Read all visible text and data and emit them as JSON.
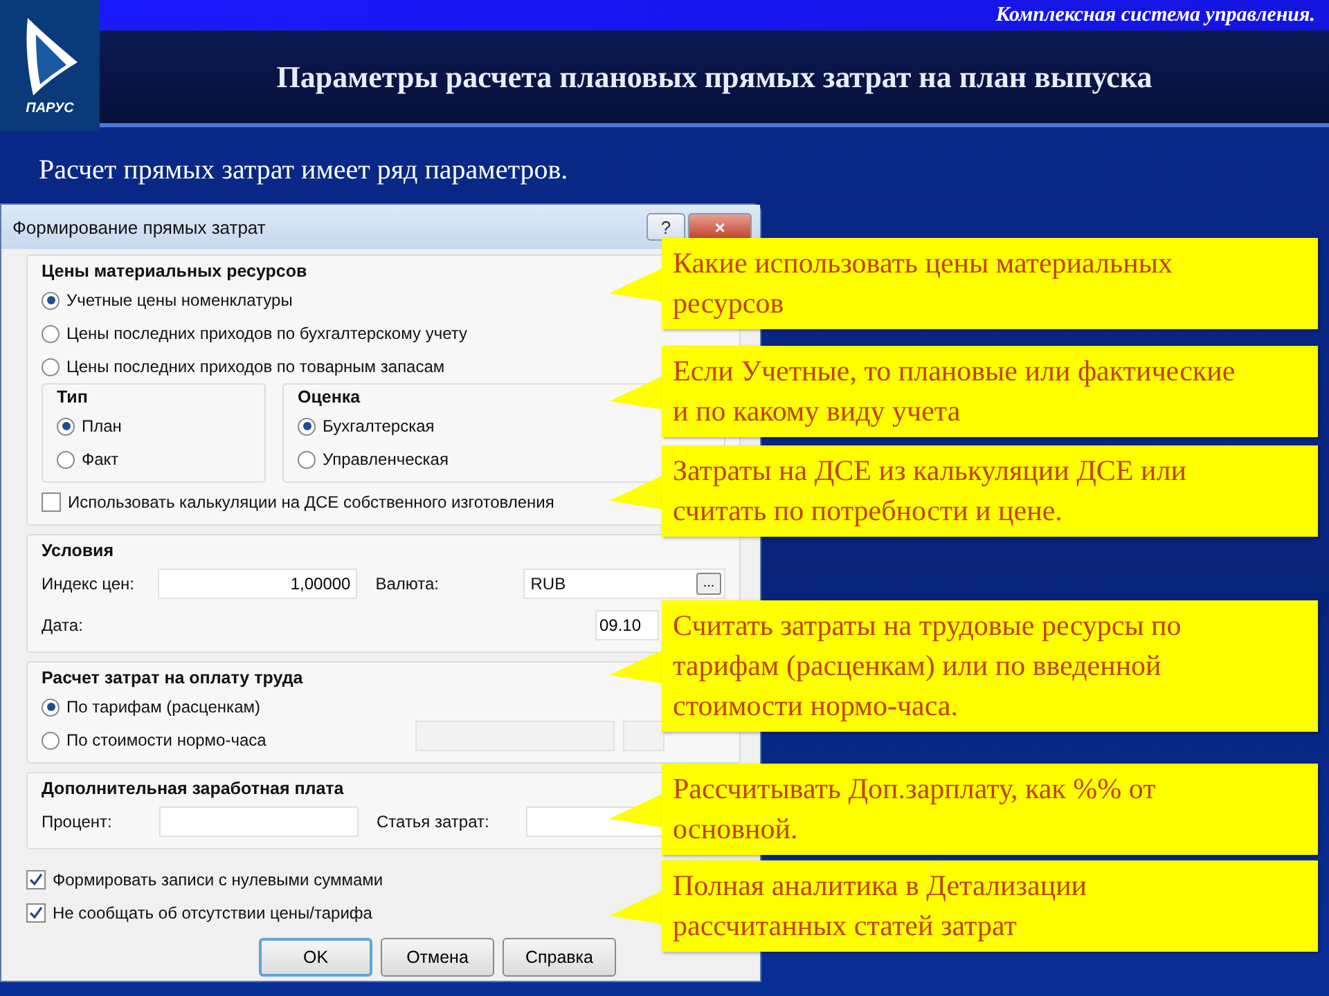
{
  "header": {
    "logo_text": "ПАРУС",
    "tagline": "Комплексная система управления.",
    "title": "Параметры расчета плановых прямых затрат на план выпуска"
  },
  "subtitle": "Расчет прямых затрат имеет ряд параметров.",
  "dialog": {
    "title": "Формирование прямых затрат",
    "help": "?",
    "close": "×",
    "prices": {
      "title": "Цены материальных ресурсов",
      "options": [
        {
          "label": "Учетные цены номенклатуры",
          "selected": true
        },
        {
          "label": "Цены последних приходов по бухгалтерскому учету",
          "selected": false
        },
        {
          "label": "Цены последних приходов по товарным запасам",
          "selected": false
        }
      ],
      "type": {
        "title": "Тип",
        "options": [
          {
            "label": "План",
            "selected": true
          },
          {
            "label": "Факт",
            "selected": false
          }
        ]
      },
      "valuation": {
        "title": "Оценка",
        "options": [
          {
            "label": "Бухгалтерская",
            "selected": true
          },
          {
            "label": "Управленческая",
            "selected": false
          }
        ]
      },
      "use_calc": {
        "label": "Использовать калькуляции на ДСЕ собственного изготовления",
        "checked": false
      }
    },
    "conditions": {
      "title": "Условия",
      "price_index": {
        "label": "Индекс цен:",
        "value": "1,00000"
      },
      "currency": {
        "label": "Валюта:",
        "value": "RUB",
        "browse": "..."
      },
      "date": {
        "label": "Дата:",
        "value": "09.10"
      }
    },
    "labor": {
      "title": "Расчет затрат на оплату труда",
      "options": [
        {
          "label": "По тарифам (расценкам)",
          "selected": true
        },
        {
          "label": "По стоимости нормо-часа",
          "selected": false
        }
      ],
      "rate_fields": {
        "disabled": true
      }
    },
    "extra_pay": {
      "title": "Дополнительная заработная плата",
      "percent": {
        "label": "Процент:"
      },
      "cost_item": {
        "label": "Статья затрат:"
      }
    },
    "flags": [
      {
        "label": "Формировать записи с нулевыми суммами",
        "checked": true
      },
      {
        "label": "Не сообщать об отсутствии цены/тарифа",
        "checked": true
      }
    ],
    "buttons": [
      {
        "label": "OK",
        "default": true
      },
      {
        "label": "Отмена",
        "default": false
      },
      {
        "label": "Справка",
        "default": false
      }
    ]
  },
  "callouts": [
    {
      "text": "Какие использовать цены материальных ресурсов"
    },
    {
      "text": "Если Учетные, то плановые или фактические и по какому виду учета"
    },
    {
      "text": "Затраты на ДСЕ из калькуляции ДСЕ или считать по потребности и цене."
    },
    {
      "text": "Считать затраты на трудовые ресурсы по тарифам (расценкам) или по введенной стоимости нормо-часа."
    },
    {
      "text": "Рассчитывать Доп.зарплату, как %% от основной."
    },
    {
      "text": "Полная аналитика в Детализации рассчитанных статей затрат"
    }
  ]
}
